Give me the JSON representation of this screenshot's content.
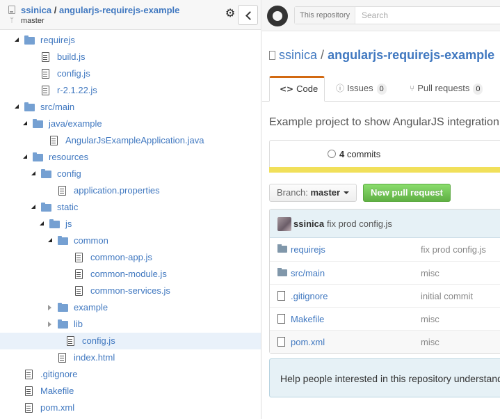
{
  "tree": {
    "header": {
      "owner": "ssinica",
      "separator": "/",
      "repo": "angularjs-requirejs-example",
      "branch": "master"
    },
    "rows": [
      {
        "label": "requirejs",
        "kind": "folder",
        "depth": 0,
        "expanded": true
      },
      {
        "label": "build.js",
        "kind": "file",
        "depth": 1
      },
      {
        "label": "config.js",
        "kind": "file",
        "depth": 1
      },
      {
        "label": "r-2.1.22.js",
        "kind": "file",
        "depth": 1
      },
      {
        "label": "src/main",
        "kind": "folder",
        "depth": 0,
        "expanded": true
      },
      {
        "label": "java/example",
        "kind": "folder",
        "depth": 1,
        "expanded": true
      },
      {
        "label": "AngularJsExampleApplication.java",
        "kind": "file",
        "depth": 2
      },
      {
        "label": "resources",
        "kind": "folder",
        "depth": 1,
        "expanded": true
      },
      {
        "label": "config",
        "kind": "folder",
        "depth": 2,
        "expanded": true
      },
      {
        "label": "application.properties",
        "kind": "file",
        "depth": 3
      },
      {
        "label": "static",
        "kind": "folder",
        "depth": 2,
        "expanded": true
      },
      {
        "label": "js",
        "kind": "folder",
        "depth": 3,
        "expanded": true
      },
      {
        "label": "common",
        "kind": "folder",
        "depth": 4,
        "expanded": true
      },
      {
        "label": "common-app.js",
        "kind": "file",
        "depth": 5
      },
      {
        "label": "common-module.js",
        "kind": "file",
        "depth": 5
      },
      {
        "label": "common-services.js",
        "kind": "file",
        "depth": 5
      },
      {
        "label": "example",
        "kind": "folder",
        "depth": 4,
        "expanded": false
      },
      {
        "label": "lib",
        "kind": "folder",
        "depth": 4,
        "expanded": false
      },
      {
        "label": "config.js",
        "kind": "file",
        "depth": 4,
        "selected": true
      },
      {
        "label": "index.html",
        "kind": "file",
        "depth": 3
      },
      {
        "label": ".gitignore",
        "kind": "file",
        "depth": -1
      },
      {
        "label": "Makefile",
        "kind": "file",
        "depth": -1
      },
      {
        "label": "pom.xml",
        "kind": "file",
        "depth": -1
      }
    ]
  },
  "github": {
    "search": {
      "scope": "This repository",
      "placeholder": "Search"
    },
    "repo": {
      "owner": "ssinica",
      "separator": "/",
      "name": "angularjs-requirejs-example"
    },
    "tabs": [
      {
        "icon": "<>",
        "label": "Code",
        "active": true
      },
      {
        "icon": "ⓘ",
        "label": "Issues",
        "count": "0"
      },
      {
        "icon": "⑂",
        "label": "Pull requests",
        "count": "0"
      }
    ],
    "description": "Example project to show AngularJS integration with RequireJS",
    "commits": {
      "count": "4",
      "label": "commits"
    },
    "branch": {
      "label": "Branch:",
      "value": "master"
    },
    "new_pr": "New pull request",
    "last_commit": {
      "author": "ssinica",
      "message": "fix prod config.js"
    },
    "files": [
      {
        "name": "requirejs",
        "kind": "folder",
        "message": "fix prod config.js"
      },
      {
        "name": "src/main",
        "kind": "folder",
        "message": "misc"
      },
      {
        "name": ".gitignore",
        "kind": "file",
        "message": "initial commit"
      },
      {
        "name": "Makefile",
        "kind": "file",
        "message": "misc"
      },
      {
        "name": "pom.xml",
        "kind": "file",
        "message": "misc"
      }
    ],
    "readme_help": "Help people interested in this repository understand your project by adding a README."
  }
}
